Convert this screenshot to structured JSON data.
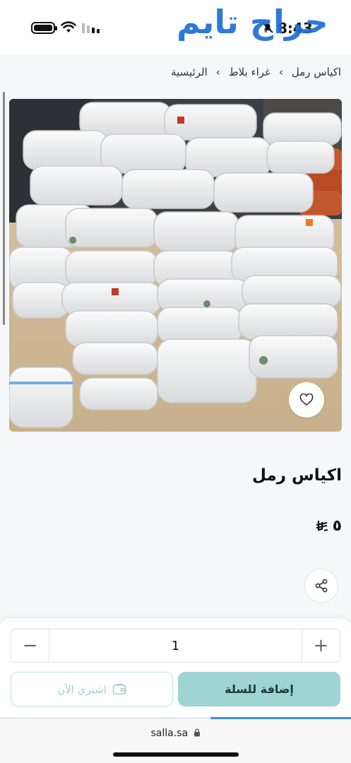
{
  "status": {
    "time": "8:43",
    "icons": [
      "battery-icon",
      "wifi-icon",
      "signal-icon",
      "bell-muted-icon"
    ]
  },
  "watermark": {
    "text": "حراج تايم"
  },
  "breadcrumb": {
    "items": [
      "الرئيسية",
      "غراء بلاط",
      "اكياس رمل"
    ],
    "separator": "›"
  },
  "product": {
    "title": "اكياس رمل",
    "price": "٥",
    "currency_icon": "saudi-riyal-icon",
    "image_desc_icon": "sand-bags-photo"
  },
  "actions": {
    "wishlist_icon": "heart-icon",
    "share_icon": "share-icon"
  },
  "quantity": {
    "value": "1",
    "minus": "−",
    "plus": "+"
  },
  "buttons": {
    "add_to_cart": "إضافة للسلة",
    "buy_now": "اشتري الآن",
    "buy_now_icon": "wallet-icon"
  },
  "browser": {
    "url": "salla.sa",
    "lock_icon": "lock-icon",
    "load_progress": 0.4
  },
  "colors": {
    "accent": "#9fd4d3",
    "buy_border": "#bfe4e4",
    "progress": "#3d8fe0",
    "logo": "#1f6fd6"
  }
}
